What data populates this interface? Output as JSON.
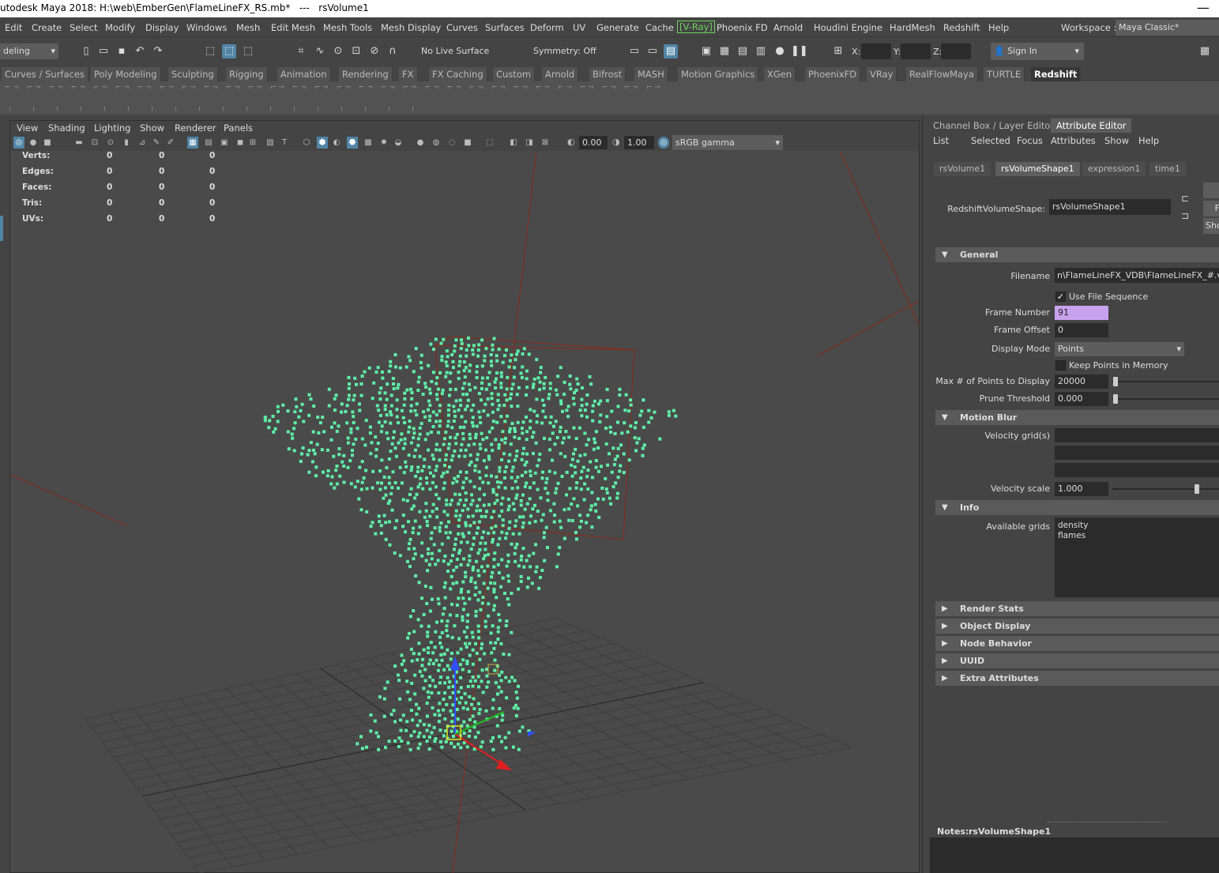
{
  "titlebar": {
    "title": "utodesk Maya 2018: H:\\web\\EmberGen\\FlameLineFX_RS.mb*   ---   rsVolume1",
    "close": "—"
  },
  "menubar": {
    "items": [
      "Edit",
      "Create",
      "Select",
      "Modify",
      "Display",
      "Windows",
      "Mesh",
      "Edit Mesh",
      "Mesh Tools",
      "Mesh Display",
      "Curves",
      "Surfaces",
      "Deform",
      "UV",
      "Generate",
      "Cache",
      "[V-Ray]",
      "Phoenix FD",
      "Arnold",
      "Houdini Engine",
      "HardMesh",
      "Redshift",
      "Help"
    ],
    "workspace_label": "Workspace :",
    "workspace_value": "Maya Classic*"
  },
  "statusline": {
    "mode": "deling",
    "live_surface": "No Live Surface",
    "symmetry": "Symmetry: Off",
    "x_label": "X:",
    "y_label": "Y:",
    "z_label": "Z:",
    "signin": "Sign In"
  },
  "shelf_tabs": [
    "Curves / Surfaces",
    "Poly Modeling",
    "Sculpting",
    "Rigging",
    "Animation",
    "Rendering",
    "FX",
    "FX Caching",
    "Custom",
    "Arnold",
    "Bifrost",
    "MASH",
    "Motion Graphics",
    "XGen",
    "PhoenixFD",
    "VRay",
    "RealFlowMaya",
    "TURTLE",
    "Redshift"
  ],
  "shelf_active": "Redshift",
  "viewport": {
    "menu": [
      "View",
      "Shading",
      "Lighting",
      "Show",
      "Renderer",
      "Panels"
    ],
    "exposure": "0.00",
    "gamma": "1.00",
    "colorspace": "sRGB gamma",
    "hud": [
      {
        "label": "Verts:",
        "a": "0",
        "b": "0",
        "c": "0"
      },
      {
        "label": "Edges:",
        "a": "0",
        "b": "0",
        "c": "0"
      },
      {
        "label": "Faces:",
        "a": "0",
        "b": "0",
        "c": "0"
      },
      {
        "label": "Tris:",
        "a": "0",
        "b": "0",
        "c": "0"
      },
      {
        "label": "UVs:",
        "a": "0",
        "b": "0",
        "c": "0"
      }
    ],
    "colors": {
      "points": "#5ff0a8",
      "grid": "#3e3e3e",
      "bg": "#4a4a4a",
      "bbox": "#8a2a18"
    }
  },
  "panel": {
    "tabs": [
      "Channel Box / Layer Editor",
      "Attribute Editor"
    ],
    "active_tab": "Attribute Editor",
    "menu": [
      "List",
      "Selected",
      "Focus",
      "Attributes",
      "Show",
      "Help"
    ],
    "node_tabs": [
      "rsVolume1",
      "rsVolumeShape1",
      "expression1",
      "time1"
    ],
    "active_node": "rsVolumeShape1",
    "node_label": "RedshiftVolumeShape:",
    "node_value": "rsVolumeShape1",
    "side_buttons": [
      "F",
      "Sho"
    ],
    "general": {
      "title": "General",
      "filename_label": "Filename",
      "filename_value": "n\\FlameLineFX_VDB\\FlameLineFX_#.vdb",
      "use_file_sequence": "Use File Sequence",
      "frame_number_label": "Frame Number",
      "frame_number_value": "91",
      "frame_offset_label": "Frame Offset",
      "frame_offset_value": "0",
      "display_mode_label": "Display Mode",
      "display_mode_value": "Points",
      "keep_points": "Keep Points in Memory",
      "max_points_label": "Max # of Points to Display",
      "max_points_value": "20000",
      "prune_label": "Prune Threshold",
      "prune_value": "0.000"
    },
    "motion_blur": {
      "title": "Motion Blur",
      "velocity_grids_label": "Velocity grid(s)",
      "velocity_scale_label": "Velocity scale",
      "velocity_scale_value": "1.000",
      "velocity_scale_level": 0.8
    },
    "info": {
      "title": "Info",
      "available_label": "Available grids",
      "grid1": "density",
      "grid2": "flames"
    },
    "collapsed": [
      "Render Stats",
      "Object Display",
      "Node Behavior",
      "UUID",
      "Extra Attributes"
    ],
    "notes_label": "Notes:",
    "notes_value": "rsVolumeShape1"
  }
}
